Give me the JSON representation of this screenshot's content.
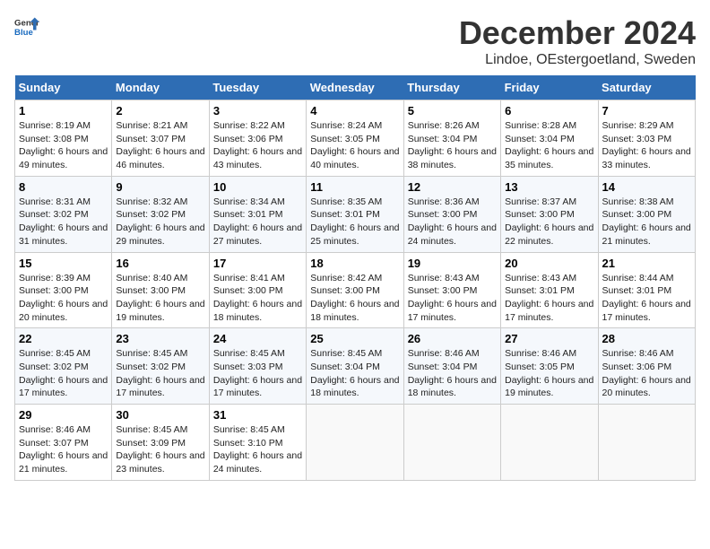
{
  "header": {
    "logo_general": "General",
    "logo_blue": "Blue",
    "month": "December 2024",
    "location": "Lindoe, OEstergoetland, Sweden"
  },
  "weekdays": [
    "Sunday",
    "Monday",
    "Tuesday",
    "Wednesday",
    "Thursday",
    "Friday",
    "Saturday"
  ],
  "weeks": [
    [
      {
        "day": "1",
        "sunrise": "Sunrise: 8:19 AM",
        "sunset": "Sunset: 3:08 PM",
        "daylight": "Daylight: 6 hours and 49 minutes."
      },
      {
        "day": "2",
        "sunrise": "Sunrise: 8:21 AM",
        "sunset": "Sunset: 3:07 PM",
        "daylight": "Daylight: 6 hours and 46 minutes."
      },
      {
        "day": "3",
        "sunrise": "Sunrise: 8:22 AM",
        "sunset": "Sunset: 3:06 PM",
        "daylight": "Daylight: 6 hours and 43 minutes."
      },
      {
        "day": "4",
        "sunrise": "Sunrise: 8:24 AM",
        "sunset": "Sunset: 3:05 PM",
        "daylight": "Daylight: 6 hours and 40 minutes."
      },
      {
        "day": "5",
        "sunrise": "Sunrise: 8:26 AM",
        "sunset": "Sunset: 3:04 PM",
        "daylight": "Daylight: 6 hours and 38 minutes."
      },
      {
        "day": "6",
        "sunrise": "Sunrise: 8:28 AM",
        "sunset": "Sunset: 3:04 PM",
        "daylight": "Daylight: 6 hours and 35 minutes."
      },
      {
        "day": "7",
        "sunrise": "Sunrise: 8:29 AM",
        "sunset": "Sunset: 3:03 PM",
        "daylight": "Daylight: 6 hours and 33 minutes."
      }
    ],
    [
      {
        "day": "8",
        "sunrise": "Sunrise: 8:31 AM",
        "sunset": "Sunset: 3:02 PM",
        "daylight": "Daylight: 6 hours and 31 minutes."
      },
      {
        "day": "9",
        "sunrise": "Sunrise: 8:32 AM",
        "sunset": "Sunset: 3:02 PM",
        "daylight": "Daylight: 6 hours and 29 minutes."
      },
      {
        "day": "10",
        "sunrise": "Sunrise: 8:34 AM",
        "sunset": "Sunset: 3:01 PM",
        "daylight": "Daylight: 6 hours and 27 minutes."
      },
      {
        "day": "11",
        "sunrise": "Sunrise: 8:35 AM",
        "sunset": "Sunset: 3:01 PM",
        "daylight": "Daylight: 6 hours and 25 minutes."
      },
      {
        "day": "12",
        "sunrise": "Sunrise: 8:36 AM",
        "sunset": "Sunset: 3:00 PM",
        "daylight": "Daylight: 6 hours and 24 minutes."
      },
      {
        "day": "13",
        "sunrise": "Sunrise: 8:37 AM",
        "sunset": "Sunset: 3:00 PM",
        "daylight": "Daylight: 6 hours and 22 minutes."
      },
      {
        "day": "14",
        "sunrise": "Sunrise: 8:38 AM",
        "sunset": "Sunset: 3:00 PM",
        "daylight": "Daylight: 6 hours and 21 minutes."
      }
    ],
    [
      {
        "day": "15",
        "sunrise": "Sunrise: 8:39 AM",
        "sunset": "Sunset: 3:00 PM",
        "daylight": "Daylight: 6 hours and 20 minutes."
      },
      {
        "day": "16",
        "sunrise": "Sunrise: 8:40 AM",
        "sunset": "Sunset: 3:00 PM",
        "daylight": "Daylight: 6 hours and 19 minutes."
      },
      {
        "day": "17",
        "sunrise": "Sunrise: 8:41 AM",
        "sunset": "Sunset: 3:00 PM",
        "daylight": "Daylight: 6 hours and 18 minutes."
      },
      {
        "day": "18",
        "sunrise": "Sunrise: 8:42 AM",
        "sunset": "Sunset: 3:00 PM",
        "daylight": "Daylight: 6 hours and 18 minutes."
      },
      {
        "day": "19",
        "sunrise": "Sunrise: 8:43 AM",
        "sunset": "Sunset: 3:00 PM",
        "daylight": "Daylight: 6 hours and 17 minutes."
      },
      {
        "day": "20",
        "sunrise": "Sunrise: 8:43 AM",
        "sunset": "Sunset: 3:01 PM",
        "daylight": "Daylight: 6 hours and 17 minutes."
      },
      {
        "day": "21",
        "sunrise": "Sunrise: 8:44 AM",
        "sunset": "Sunset: 3:01 PM",
        "daylight": "Daylight: 6 hours and 17 minutes."
      }
    ],
    [
      {
        "day": "22",
        "sunrise": "Sunrise: 8:45 AM",
        "sunset": "Sunset: 3:02 PM",
        "daylight": "Daylight: 6 hours and 17 minutes."
      },
      {
        "day": "23",
        "sunrise": "Sunrise: 8:45 AM",
        "sunset": "Sunset: 3:02 PM",
        "daylight": "Daylight: 6 hours and 17 minutes."
      },
      {
        "day": "24",
        "sunrise": "Sunrise: 8:45 AM",
        "sunset": "Sunset: 3:03 PM",
        "daylight": "Daylight: 6 hours and 17 minutes."
      },
      {
        "day": "25",
        "sunrise": "Sunrise: 8:45 AM",
        "sunset": "Sunset: 3:04 PM",
        "daylight": "Daylight: 6 hours and 18 minutes."
      },
      {
        "day": "26",
        "sunrise": "Sunrise: 8:46 AM",
        "sunset": "Sunset: 3:04 PM",
        "daylight": "Daylight: 6 hours and 18 minutes."
      },
      {
        "day": "27",
        "sunrise": "Sunrise: 8:46 AM",
        "sunset": "Sunset: 3:05 PM",
        "daylight": "Daylight: 6 hours and 19 minutes."
      },
      {
        "day": "28",
        "sunrise": "Sunrise: 8:46 AM",
        "sunset": "Sunset: 3:06 PM",
        "daylight": "Daylight: 6 hours and 20 minutes."
      }
    ],
    [
      {
        "day": "29",
        "sunrise": "Sunrise: 8:46 AM",
        "sunset": "Sunset: 3:07 PM",
        "daylight": "Daylight: 6 hours and 21 minutes."
      },
      {
        "day": "30",
        "sunrise": "Sunrise: 8:45 AM",
        "sunset": "Sunset: 3:09 PM",
        "daylight": "Daylight: 6 hours and 23 minutes."
      },
      {
        "day": "31",
        "sunrise": "Sunrise: 8:45 AM",
        "sunset": "Sunset: 3:10 PM",
        "daylight": "Daylight: 6 hours and 24 minutes."
      },
      null,
      null,
      null,
      null
    ]
  ]
}
